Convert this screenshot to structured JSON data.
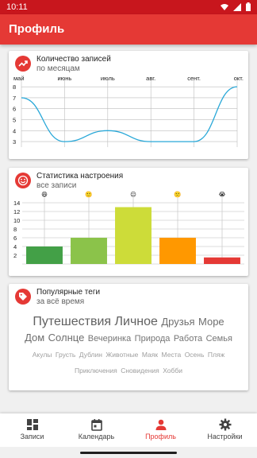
{
  "status_bar": {
    "time": "10:11",
    "icons": [
      "wifi-icon",
      "signal-icon",
      "battery-icon"
    ]
  },
  "app_bar": {
    "title": "Профиль",
    "color": "#e53935"
  },
  "entries_card": {
    "title": "Количество записей",
    "subtitle": "по месяцам",
    "icon": "trending-up-icon"
  },
  "mood_card": {
    "title": "Статистика настроения",
    "subtitle": "все записи",
    "icon": "smile-icon"
  },
  "tags_card": {
    "title": "Популярные теги",
    "subtitle": "за всё время",
    "icon": "tag-icon",
    "rows": [
      [
        {
          "text": "Путешествия",
          "size": "large"
        },
        {
          "text": "Личное",
          "size": "large"
        },
        {
          "text": "Друзья",
          "size": "medium-large"
        },
        {
          "text": "Море",
          "size": "medium-large"
        }
      ],
      [
        {
          "text": "Дом",
          "size": "medium-large"
        },
        {
          "text": "Солнце",
          "size": "medium-large"
        },
        {
          "text": "Вечеринка",
          "size": "medium"
        },
        {
          "text": "Природа",
          "size": "medium"
        },
        {
          "text": "Работа",
          "size": "medium"
        },
        {
          "text": "Семья",
          "size": "medium"
        }
      ],
      [
        {
          "text": "Акулы",
          "size": "small"
        },
        {
          "text": "Грусть",
          "size": "small"
        },
        {
          "text": "Дублин",
          "size": "small"
        },
        {
          "text": "Животные",
          "size": "small"
        },
        {
          "text": "Маяк",
          "size": "small"
        },
        {
          "text": "Места",
          "size": "small"
        },
        {
          "text": "Осень",
          "size": "small"
        },
        {
          "text": "Пляж",
          "size": "small"
        }
      ],
      [
        {
          "text": "Приключения",
          "size": "small"
        },
        {
          "text": "Сновидения",
          "size": "small"
        },
        {
          "text": "Хобби",
          "size": "small"
        }
      ]
    ]
  },
  "bottom_nav": [
    {
      "label": "Записи",
      "icon": "dashboard-icon",
      "active": false
    },
    {
      "label": "Календарь",
      "icon": "calendar-icon",
      "active": false
    },
    {
      "label": "Профиль",
      "icon": "person-icon",
      "active": true
    },
    {
      "label": "Настройки",
      "icon": "gear-icon",
      "active": false
    }
  ],
  "chart_data": [
    {
      "type": "line",
      "x": [
        "май",
        "июнь",
        "июль",
        "авг.",
        "сент.",
        "окт."
      ],
      "values": [
        7,
        3,
        4,
        3,
        3,
        8
      ],
      "ylim": [
        2.5,
        8.3
      ],
      "yticks": [
        3,
        4,
        5,
        6,
        7,
        8
      ],
      "grid": true,
      "color": "#29a8d8"
    },
    {
      "type": "bar",
      "categories": [
        "ecstatic",
        "happy",
        "neutral",
        "sad",
        "crying"
      ],
      "category_emojis": [
        "😄",
        "🙂",
        "😐",
        "🙁",
        "😭"
      ],
      "values": [
        4,
        6,
        13,
        6,
        1.5
      ],
      "colors": [
        "#43a047",
        "#8bc34a",
        "#cddc39",
        "#ff9800",
        "#e53935"
      ],
      "ylim": [
        0,
        14
      ],
      "yticks": [
        2,
        4,
        6,
        8,
        10,
        12,
        14
      ],
      "grid": true
    }
  ]
}
